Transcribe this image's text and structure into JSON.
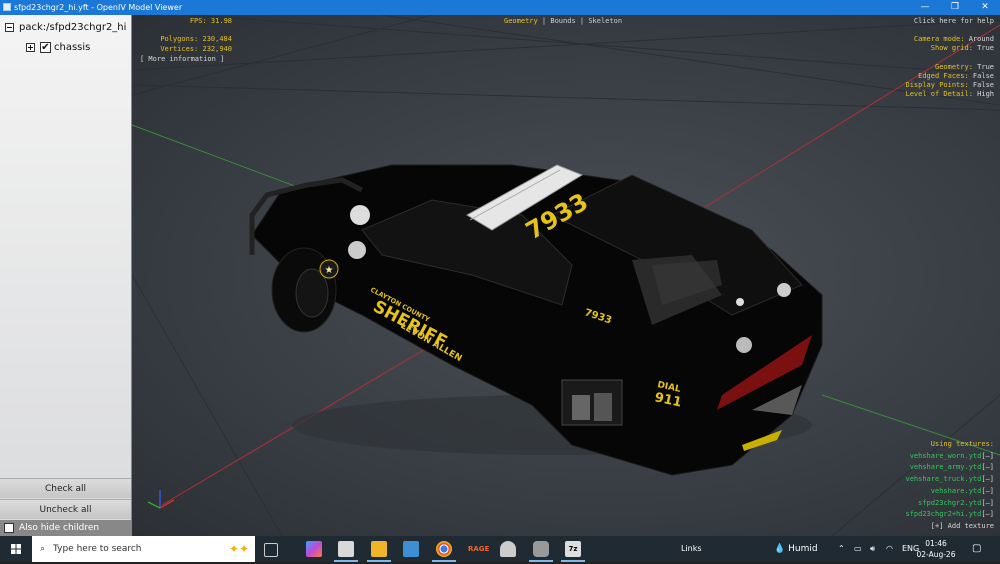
{
  "window": {
    "title": "sfpd23chgr2_hi.yft - OpenIV Model Viewer",
    "min_label": "—",
    "max_label": "❐",
    "close_label": "✕"
  },
  "tree": {
    "root_label": "pack:/sfpd23chgr2_hi",
    "child_label": "chassis",
    "child_checked": "✔"
  },
  "panel": {
    "check_all": "Check all",
    "uncheck_all": "Uncheck all",
    "hide_children": "Also hide children"
  },
  "hud": {
    "fps_label": "FPS:",
    "fps_value": "31.98",
    "polygons_label": "Polygons:",
    "polygons_value": "230,484",
    "vertices_label": "Vertices:",
    "vertices_value": "232,940",
    "more_info": "[ More information ]",
    "mode_geometry": "Geometry",
    "mode_bounds": "Bounds",
    "mode_skeleton": "Skeleton",
    "help": "Click here for help",
    "camera_label": "Camera mode:",
    "camera_value": "Around",
    "grid_label": "Show grid:",
    "grid_value": "True",
    "geometry_label": "Geometry:",
    "geometry_value": "True",
    "edged_label": "Edged Faces:",
    "edged_value": "False",
    "points_label": "Display Points:",
    "points_value": "False",
    "lod_label": "Level of Detail:",
    "lod_value": "High"
  },
  "textures": {
    "heading": "Using textures:",
    "items": [
      "vehshare_worn.ytd",
      "vehshare_army.ytd",
      "vehshare_truck.ytd",
      "vehshare.ytd",
      "sfpd23chgr2.ytd",
      "sfpd23chgr2+hi.ytd"
    ],
    "toggle": "[–]",
    "add": "[+] Add texture"
  },
  "car": {
    "roof_number": "7933",
    "side_number": "7933",
    "county": "CLAYTON COUNTY",
    "dept": "SHERIFF",
    "name": "LEVON ALLEN",
    "dial": "DIAL",
    "emergency": "911"
  },
  "taskbar": {
    "search_placeholder": "Type here to search",
    "links": "Links",
    "weather": "Humid",
    "lang": "ENG",
    "time": "01:46",
    "date": "02-Aug-26"
  },
  "colors": {
    "titlebar": "#1b78d6",
    "hud_yellow": "#e2c12b",
    "texture_green": "#34c75a"
  }
}
